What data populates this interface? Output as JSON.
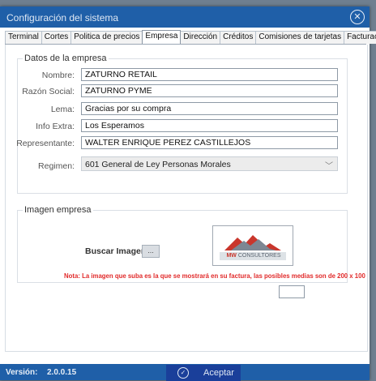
{
  "window": {
    "title": "Configuración del sistema",
    "close_icon": "close-circle-icon"
  },
  "tabs": [
    {
      "label": "Terminal"
    },
    {
      "label": "Cortes"
    },
    {
      "label": "Politica de precios"
    },
    {
      "label": "Empresa",
      "active": true
    },
    {
      "label": "Dirección"
    },
    {
      "label": "Créditos"
    },
    {
      "label": "Comisiones de tarjetas"
    },
    {
      "label": "Facturación"
    }
  ],
  "company": {
    "group_title": "Datos de la empresa",
    "name_label": "Nombre:",
    "name_value": "ZATURNO RETAIL",
    "legal_label": "Razón Social:",
    "legal_value": "ZATURNO PYME",
    "slogan_label": "Lema:",
    "slogan_value": "Gracias por su compra",
    "extra_label": "Info Extra:",
    "extra_value": "Los Esperamos",
    "rep_label": "Representante:",
    "rep_value": "WALTER ENRIQUE PEREZ CASTILLEJOS",
    "regime_label": "Regimen:",
    "regime_value": "601  General de Ley Personas Morales"
  },
  "image": {
    "group_title": "Imagen empresa",
    "browse_label": "Buscar Imagen:",
    "browse_button": "...",
    "logo_text_mw": "MW",
    "logo_text_rest": "CONSULTORES",
    "note": "Nota: La imagen que suba es la que se mostrará en su factura, las posibles medias son de 200 x 100"
  },
  "footer": {
    "version_label": "Versión:",
    "version_value": "2.0.0.15",
    "accept_label": "Aceptar"
  },
  "colors": {
    "titlebar": "#1f5fa8",
    "accent_button": "#1a3f9a",
    "note_red": "#e12a2a"
  }
}
